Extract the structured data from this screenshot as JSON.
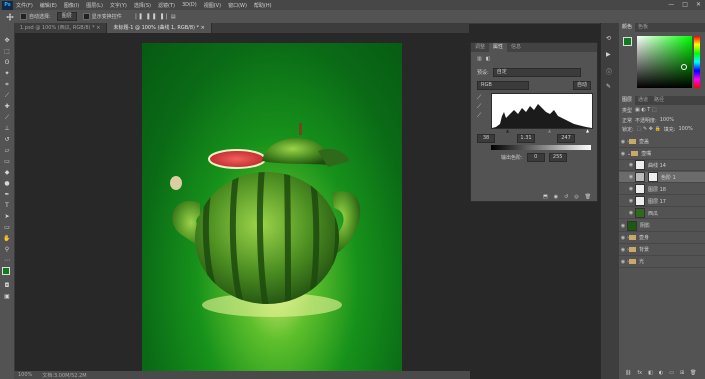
{
  "app": {
    "logo": "Ps",
    "menu": [
      "文件(F)",
      "编辑(E)",
      "图像(I)",
      "图层(L)",
      "文字(Y)",
      "选择(S)",
      "滤镜(T)",
      "3D(D)",
      "视图(V)",
      "窗口(W)",
      "帮助(H)"
    ],
    "window_controls": [
      "—",
      "□",
      "✕"
    ]
  },
  "options_bar": {
    "auto_select_label": "自动选择:",
    "auto_select_value": "图层",
    "transform_label": "显示变换控件"
  },
  "tabs": [
    {
      "label": "1.psd @ 100% (西瓜, RGB/8) *",
      "close": "×"
    },
    {
      "label": "未标题-1 @ 100% (曲线 1, RGB/8) *",
      "close": "×"
    }
  ],
  "status": {
    "zoom": "100%",
    "doc": "文档:3.00M/52.2M"
  },
  "properties": {
    "tabs": [
      "调整",
      "属性",
      "信息"
    ],
    "active_tab": 1,
    "preset_label": "预设:",
    "preset_value": "自定",
    "channel_value": "RGB",
    "auto_label": "自动",
    "input_black": "38",
    "input_gamma": "1.31",
    "input_white": "247",
    "output_label": "输出色阶:",
    "output_black": "0",
    "output_white": "255"
  },
  "color_panel": {
    "tabs": [
      "颜色",
      "色板"
    ],
    "foreground": "#0f7a1e",
    "background": "#ffffff",
    "accent": "#1ac81a"
  },
  "layers_panel": {
    "tabs": [
      "图层",
      "通道",
      "路径"
    ],
    "kind_label": "类型",
    "blend_mode": "正常",
    "opacity_label": "不透明度:",
    "opacity_value": "100%",
    "lock_label": "锁定:",
    "fill_label": "填充:",
    "fill_value": "100%",
    "layers": [
      {
        "name": "壶盖",
        "kind": "folder"
      },
      {
        "name": "壶嘴",
        "kind": "folder"
      },
      {
        "name": "曲线 14",
        "kind": "adj"
      },
      {
        "name": "色阶 1",
        "kind": "adj",
        "selected": true
      },
      {
        "name": "图层 18",
        "kind": "pixel"
      },
      {
        "name": "图层 17",
        "kind": "pixel"
      },
      {
        "name": "西瓜",
        "kind": "pixel"
      },
      {
        "name": "阴影",
        "kind": "pixel"
      },
      {
        "name": "壶身",
        "kind": "folder"
      },
      {
        "name": "背景",
        "kind": "folder"
      },
      {
        "name": "光",
        "kind": "folder"
      }
    ]
  }
}
